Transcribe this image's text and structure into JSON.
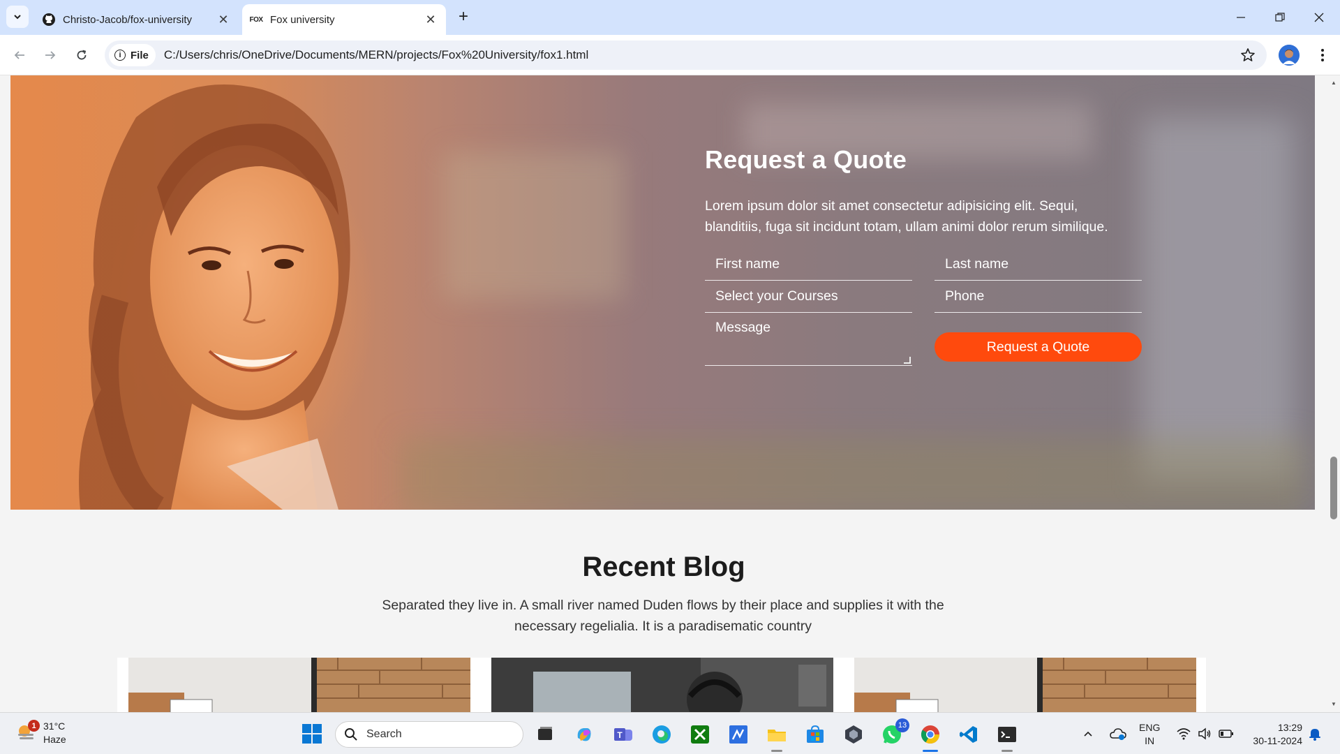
{
  "browser": {
    "tabs": [
      {
        "title": "Christo-Jacob/fox-university",
        "active": false,
        "favicon": "github-icon"
      },
      {
        "title": "Fox university",
        "active": true,
        "favicon": "fox-logo-icon"
      }
    ],
    "tab_favicon_text": "FOX",
    "new_tab_label": "+",
    "close_label": "✕",
    "address_chip": "File",
    "url": "C:/Users/chris/OneDrive/Documents/MERN/projects/Fox%20University/fox1.html"
  },
  "quote": {
    "title": "Request a Quote",
    "description": "Lorem ipsum dolor sit amet consectetur adipisicing elit. Sequi, blanditiis, fuga sit incidunt totam, ullam animi dolor rerum similique.",
    "fields": {
      "first_name": "First name",
      "last_name": "Last name",
      "courses": "Select your Courses",
      "phone": "Phone",
      "message": "Message"
    },
    "button": "Request a Quote",
    "button_color": "#ff4a0d",
    "overlay_color": "#e5894b"
  },
  "blog": {
    "title": "Recent Blog",
    "subtitle": "Separated they live in. A small river named Duden flows by their place and supplies it with the necessary regelialia. It is a paradisematic country"
  },
  "taskbar": {
    "weather_temp": "31°C",
    "weather_desc": "Haze",
    "weather_badge": "1",
    "search_label": "Search",
    "whatsapp_badge": "13",
    "lang_top": "ENG",
    "lang_bottom": "IN",
    "time": "13:29",
    "date": "30-11-2024",
    "pinned_apps": [
      "file-explorer-icon",
      "copilot-icon",
      "teams-icon",
      "edge-icon",
      "xbox-icon",
      "vscode-insiders-icon",
      "folder-icon",
      "store-icon",
      "obs-icon",
      "whatsapp-icon",
      "chrome-icon",
      "vscode-icon",
      "terminal-icon"
    ]
  }
}
